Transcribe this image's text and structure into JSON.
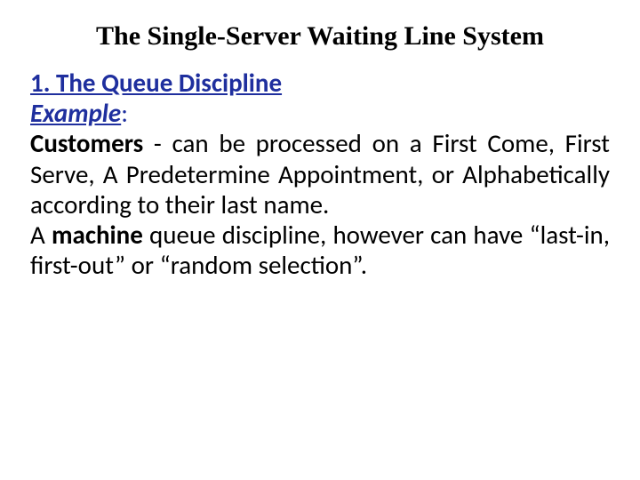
{
  "title": "The Single-Server Waiting Line System",
  "section": {
    "heading": "1. The Queue Discipline",
    "example_label": "Example",
    "example_colon": ":",
    "customers_label": "Customers",
    "customers_rest": " -  can be processed on a First Come, First Serve, A Predetermine Appointment, or Alphabetically according to their last name.",
    "machine_pre": "A ",
    "machine_bold": "machine",
    "machine_rest": " queue discipline, however can have “last-in, first-out” or “random selection”."
  }
}
